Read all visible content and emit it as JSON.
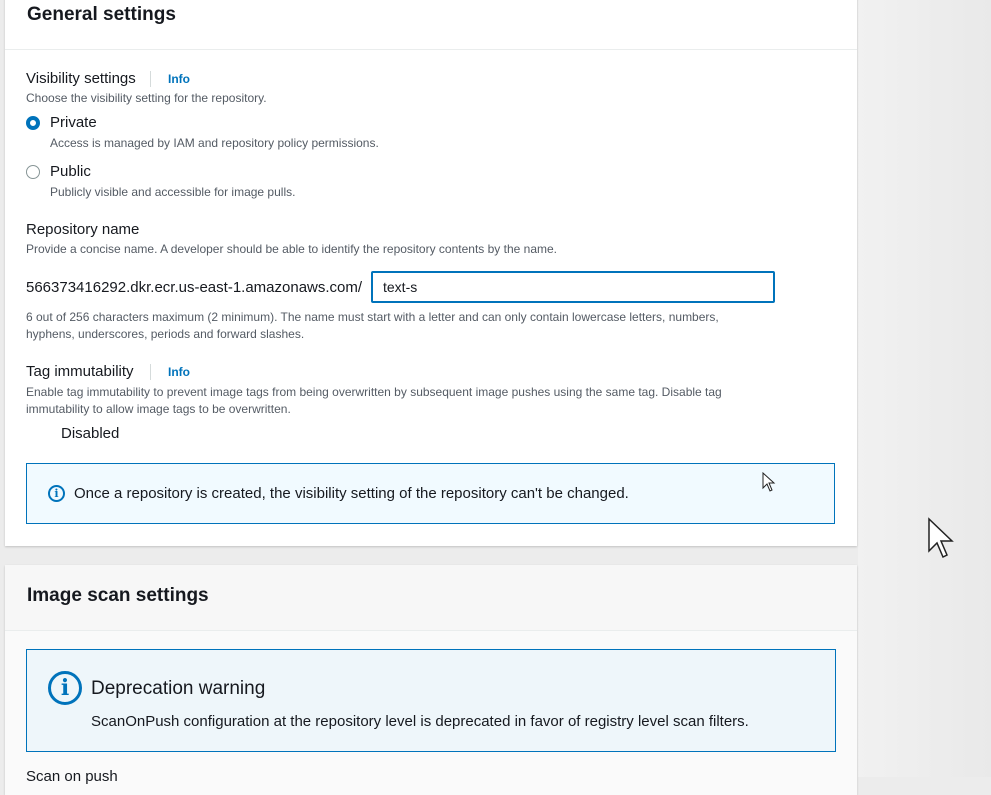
{
  "general": {
    "title": "General settings",
    "visibility": {
      "label": "Visibility settings",
      "info": "Info",
      "description": "Choose the visibility setting for the repository.",
      "options": [
        {
          "label": "Private",
          "description": "Access is managed by IAM and repository policy permissions.",
          "selected": true
        },
        {
          "label": "Public",
          "description": "Publicly visible and accessible for image pulls.",
          "selected": false
        }
      ]
    },
    "repository_name": {
      "label": "Repository name",
      "description": "Provide a concise name. A developer should be able to identify the repository contents by the name.",
      "prefix": "566373416292.dkr.ecr.us-east-1.amazonaws.com/",
      "value": "text-s",
      "constraint_line1": "6 out of 256 characters maximum (2 minimum). The name must start with a letter and can only contain lowercase letters, numbers,",
      "constraint_line2": "hyphens, underscores, periods and forward slashes."
    },
    "tag_immutability": {
      "label": "Tag immutability",
      "info": "Info",
      "description_line1": "Enable tag immutability to prevent image tags from being overwritten by subsequent image pushes using the same tag. Disable tag",
      "description_line2": "immutability to allow image tags to be overwritten.",
      "toggle_label": "Disabled",
      "enabled": false
    },
    "alert": "Once a repository is created, the visibility setting of the repository can't be changed."
  },
  "scan": {
    "title": "Image scan settings",
    "warning_title": "Deprecation warning",
    "warning_text": "ScanOnPush configuration at the repository level is deprecated in favor of registry level scan filters.",
    "scan_on_push_label": "Scan on push"
  },
  "colors": {
    "accent": "#0073bb",
    "alert_bg": "#f1faff",
    "text": "#16191f",
    "secondary_text": "#545b64"
  }
}
